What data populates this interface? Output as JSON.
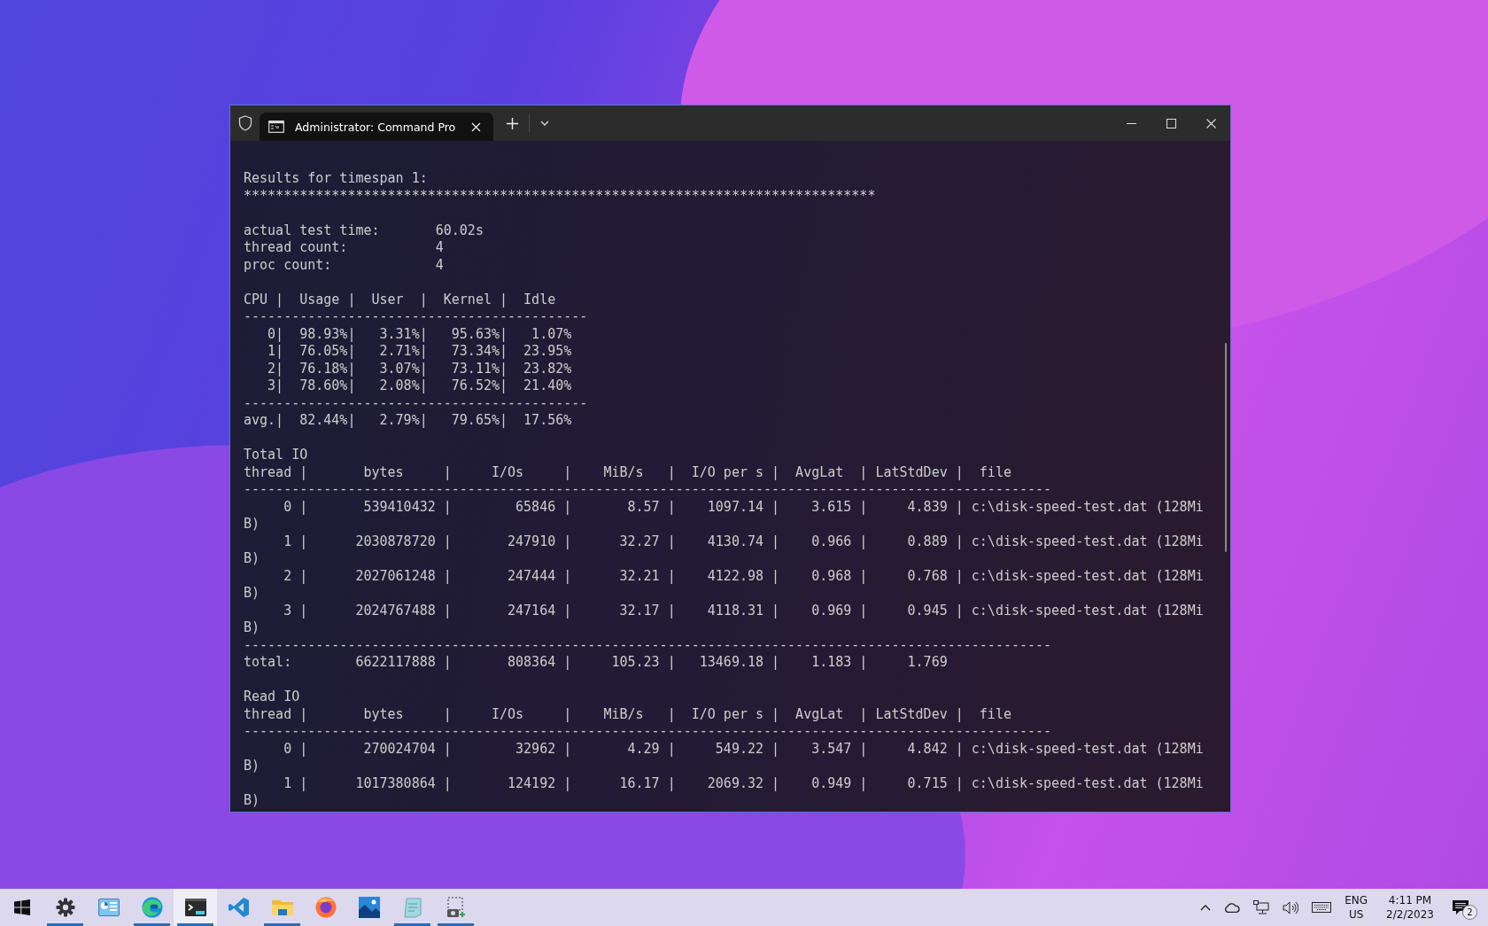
{
  "window": {
    "tabs": [
      {
        "title": "Administrator: Command Pro",
        "selected": true
      }
    ]
  },
  "terminal": {
    "blocks": [
      [
        "Results for timespan 1:",
        "*******************************************************************************"
      ],
      [
        "actual test time:       60.02s",
        "thread count:           4",
        "proc count:             4"
      ],
      [
        "CPU |  Usage |  User  |  Kernel |  Idle",
        "-------------------------------------------",
        "   0|  98.93%|   3.31%|   95.63%|   1.07%",
        "   1|  76.05%|   2.71%|   73.34%|  23.95%",
        "   2|  76.18%|   3.07%|   73.11%|  23.82%",
        "   3|  78.60%|   2.08%|   76.52%|  21.40%",
        "-------------------------------------------",
        "avg.|  82.44%|   2.79%|   79.65%|  17.56%"
      ],
      [
        "Total IO",
        "thread |       bytes     |     I/Os     |    MiB/s   |  I/O per s |  AvgLat  | LatStdDev |  file",
        "-----------------------------------------------------------------------------------------------------",
        "     0 |       539410432 |        65846 |       8.57 |    1097.14 |    3.615 |     4.839 | c:\\disk-speed-test.dat (128Mi",
        "B)",
        "     1 |      2030878720 |       247910 |      32.27 |    4130.74 |    0.966 |     0.889 | c:\\disk-speed-test.dat (128Mi",
        "B)",
        "     2 |      2027061248 |       247444 |      32.21 |    4122.98 |    0.968 |     0.768 | c:\\disk-speed-test.dat (128Mi",
        "B)",
        "     3 |      2024767488 |       247164 |      32.17 |    4118.31 |    0.969 |     0.945 | c:\\disk-speed-test.dat (128Mi",
        "B)",
        "-----------------------------------------------------------------------------------------------------",
        "total:        6622117888 |       808364 |     105.23 |   13469.18 |    1.183 |     1.769"
      ],
      [
        "Read IO",
        "thread |       bytes     |     I/Os     |    MiB/s   |  I/O per s |  AvgLat  | LatStdDev |  file",
        "-----------------------------------------------------------------------------------------------------",
        "     0 |       270024704 |        32962 |       4.29 |     549.22 |    3.547 |     4.842 | c:\\disk-speed-test.dat (128Mi",
        "B)",
        "     1 |      1017380864 |       124192 |      16.17 |    2069.32 |    0.949 |     0.715 | c:\\disk-speed-test.dat (128Mi",
        "B)"
      ]
    ]
  },
  "taskbar": {
    "apps": [
      {
        "kind": "gear",
        "running": true,
        "selected": false
      },
      {
        "kind": "panel",
        "running": false,
        "selected": false
      },
      {
        "kind": "edge",
        "running": true,
        "selected": false
      },
      {
        "kind": "terminal",
        "running": true,
        "selected": true
      },
      {
        "kind": "code",
        "running": false,
        "selected": false
      },
      {
        "kind": "folder",
        "running": true,
        "selected": false
      },
      {
        "kind": "firefox",
        "running": false,
        "selected": false
      },
      {
        "kind": "photos",
        "running": false,
        "selected": false
      },
      {
        "kind": "notepad",
        "running": true,
        "selected": false
      },
      {
        "kind": "snip",
        "running": true,
        "selected": false
      }
    ],
    "tray": {
      "language": "ENG",
      "region": "US",
      "time": "4:11 PM",
      "date": "2/2/2023",
      "notification_count": "2"
    }
  }
}
